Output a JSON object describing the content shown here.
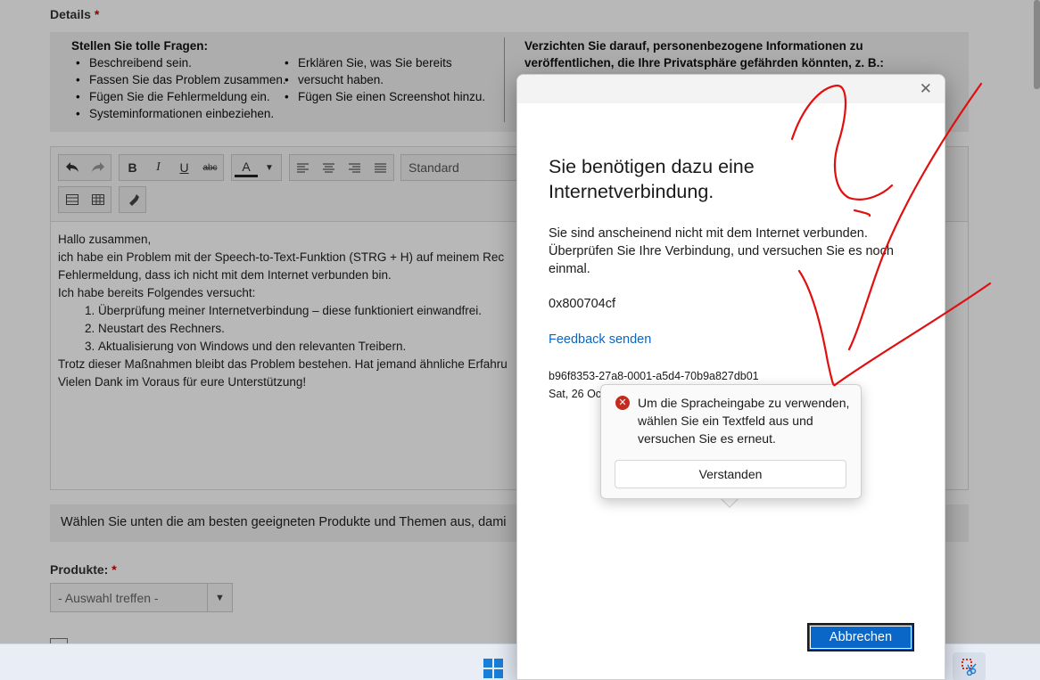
{
  "page": {
    "details_label": "Details",
    "required_mark": "*",
    "tips": {
      "left_heading": "Stellen Sie tolle Fragen:",
      "left_col1": [
        "Beschreibend sein.",
        "Fassen Sie das Problem zusammen.",
        "Fügen Sie die Fehlermeldung ein.",
        "Systeminformationen einbeziehen."
      ],
      "left_col2": [
        "Erklären Sie, was Sie bereits",
        "versucht haben.",
        "Fügen Sie einen Screenshot hinzu."
      ],
      "right_heading_line1": "Verzichten Sie darauf, personenbezogene Informationen zu",
      "right_heading_line2": "veröffentlichen, die Ihre Privatsphäre gefährden könnten, z. B.:"
    },
    "toolbar": {
      "undo_icon": "undo-icon",
      "redo_icon": "redo-icon",
      "bold": "B",
      "italic": "I",
      "underline": "U",
      "strike": "abc",
      "font_color": "A",
      "format_select": "Standard"
    },
    "editor": {
      "line1": "Hallo zusammen,",
      "line2": "ich habe ein Problem mit der Speech-to-Text-Funktion (STRG + H) auf meinem Rec",
      "line3": "Fehlermeldung, dass ich nicht mit dem Internet verbunden bin.",
      "line4": "Ich habe bereits Folgendes versucht:",
      "list": [
        "Überprüfung meiner Internetverbindung – diese funktioniert einwandfrei.",
        "Neustart des Rechners.",
        "Aktualisierung von Windows und den relevanten Treibern."
      ],
      "line5": "Trotz dieser Maßnahmen bleibt das Problem bestehen. Hat jemand ähnliche Erfahru",
      "line6": "Vielen Dank im Voraus für eure Unterstützung!"
    },
    "choose_bar": "Wählen Sie unten die am besten geeigneten Produkte und Themen aus, dami",
    "produkte_label": "Produkte:",
    "produkte_select": "- Auswahl treffen -"
  },
  "dialog": {
    "title": "Sie benötigen dazu eine Internetverbindung.",
    "body": "Sie sind anscheinend nicht mit dem Internet verbunden. Überprüfen Sie Ihre Verbindung, und versuchen Sie es noch einmal.",
    "error_code": "0x800704cf",
    "feedback_link": "Feedback senden",
    "guid": "b96f8353-27a8-0001-a5d4-70b9a827db01",
    "date": "Sat, 26 Oc",
    "cancel_button": "Abbrechen",
    "close_icon": "close-icon"
  },
  "popup": {
    "message": "Um die Spracheingabe zu verwenden, wählen Sie ein Textfeld aus und versuchen Sie es erneut.",
    "button": "Verstanden",
    "icon": "error-icon"
  },
  "colors": {
    "accent": "#0a67c8",
    "error": "#c42b1c",
    "scribble": "#e01010",
    "link": "#0a66c2"
  }
}
